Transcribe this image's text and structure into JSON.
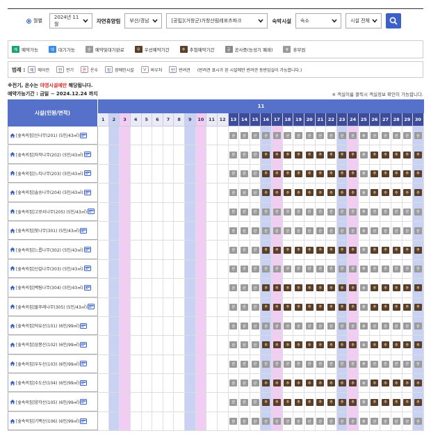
{
  "filters": {
    "radio_label": "월별",
    "month": "2024년 11월",
    "forest_label": "자연휴양림",
    "region": "부산/경남",
    "forest": "[공립](거창군)거창산림레포츠파크",
    "lodging_label": "숙박시설",
    "lodging": "숙소",
    "facility": "시설 전체"
  },
  "status_legend": [
    {
      "badge": "예",
      "label": "예약가능",
      "type": "avail"
    },
    {
      "badge": "대",
      "label": "대기가능",
      "type": "wait"
    },
    {
      "badge": "완",
      "label": "예약및대기완료",
      "type": "done"
    },
    {
      "badge": "우",
      "label": "우선예약기간",
      "type": "prio"
    },
    {
      "badge": "추",
      "label": "추첨예약기간",
      "type": "lot"
    },
    {
      "badge": "공",
      "label": "공사중(능성기 폐쇄)",
      "type": "cons"
    },
    {
      "badge": "휴",
      "label": "휴무원",
      "type": "rest"
    }
  ],
  "facility_legend": {
    "title": "범례 :",
    "items": [
      {
        "icon": "에",
        "label": "에어컨",
        "name": "aircon-icon"
      },
      {
        "icon": "전",
        "label": "전기",
        "name": "electric-icon"
      },
      {
        "icon": "온",
        "label": "온수",
        "name": "hotwater-icon"
      },
      {
        "icon": "장",
        "label": "장애인시설",
        "name": "disabled-icon"
      },
      {
        "icon": "V",
        "label": "바우처",
        "name": "voucher-icon"
      },
      {
        "icon": "반",
        "label": "반려견",
        "name": "pet-icon"
      }
    ],
    "note": "(반려견 표시가 된 시설에만 반려견 동반입실이 가능합니다.)"
  },
  "notes": {
    "line1_prefix": "※전기, 온수는 ",
    "line1_red": "야영시설에만",
    "line1_suffix": " 해당됩니다.",
    "period": "예약가능기간 : 금일 ~ 2024.12.24 까지",
    "right": "※ 객실이름 클릭시 객실정보 확인이 가능합니다."
  },
  "calendar": {
    "header_left": "시설(인원/면적)",
    "month": "11",
    "days": [
      1,
      2,
      3,
      4,
      5,
      6,
      7,
      8,
      9,
      10,
      11,
      12,
      13,
      14,
      15,
      16,
      17,
      18,
      19,
      20,
      21,
      22,
      23,
      24,
      25,
      26,
      27,
      28,
      29,
      30
    ],
    "saturdays": [
      2,
      9,
      16,
      23,
      30
    ],
    "sundays": [
      3,
      10,
      17,
      24
    ],
    "shaded_days": [
      1,
      2,
      3,
      4,
      5,
      6,
      7,
      8,
      9,
      10,
      11,
      12
    ],
    "rows": [
      {
        "name": "[숲속의집]신나무(201) (5인/43㎡)",
        "pattern": "A"
      },
      {
        "name": "[숲속의집]자작나무(202) (5인/43㎡)",
        "pattern": "B"
      },
      {
        "name": "[숲속의집]느티나무(203) (5인/43㎡)",
        "pattern": "B"
      },
      {
        "name": "[숲속의집]솔송나무(204) (5인/43㎡)",
        "pattern": "B"
      },
      {
        "name": "[숲속의집]고로쇠나무(205) (5인/43㎡)",
        "pattern": "A"
      },
      {
        "name": "[숲속의집]잣나무(301) (5인/43㎡)",
        "pattern": "A"
      },
      {
        "name": "[숲속의집]느릅나무(302) (5인/43㎡)",
        "pattern": "B"
      },
      {
        "name": "[숲속의집]신갈나무(303) (5인/43㎡)",
        "pattern": "A"
      },
      {
        "name": "[숲속의집]벽팀나무(304) (5인/43㎡)",
        "pattern": "B"
      },
      {
        "name": "[숲속의집]물푸레나무(305) (5인/43㎡)",
        "pattern": "B"
      },
      {
        "name": "[숲속의집]덕유산(101) (6인/99㎡)",
        "pattern": "A"
      },
      {
        "name": "[숲속의집]삼봉산(102) (6인/99㎡)",
        "pattern": "B"
      },
      {
        "name": "[숲속의집]우두산(103) (6인/99㎡)",
        "pattern": "A"
      },
      {
        "name": "[숲속의집]수도산(104) (6인/99㎡)",
        "pattern": "B"
      },
      {
        "name": "[숲속의집]양각산(105) (6인/99㎡)",
        "pattern": "B"
      },
      {
        "name": "[숲속의집]기백산(106) (6인/99㎡)",
        "pattern": "A"
      }
    ],
    "patterns": {
      "A": {
        "13": "완",
        "14": "완",
        "15": "완",
        "16": "완",
        "17": "완",
        "18": "완",
        "19": "완",
        "20": "완",
        "21": "완",
        "22": "완",
        "23": "완",
        "24": "완",
        "25": "휴",
        "26": "완",
        "27": "완",
        "28": "완",
        "29": "완",
        "30": "완"
      },
      "B": {
        "13": "완",
        "14": "완",
        "15": "완",
        "16": "추",
        "17": "추",
        "18": "추",
        "19": "추",
        "20": "추",
        "21": "추",
        "22": "추",
        "23": "추",
        "24": "추",
        "25": "휴",
        "26": "추",
        "27": "추",
        "28": "추",
        "29": "추",
        "30": "추"
      }
    }
  }
}
